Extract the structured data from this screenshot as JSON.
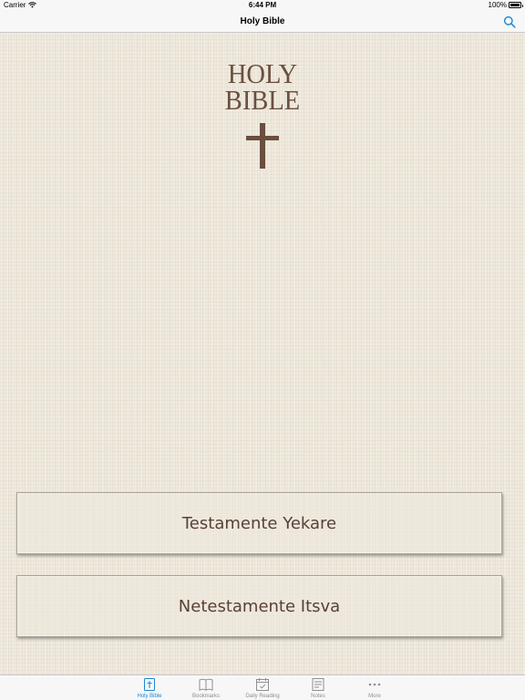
{
  "status_bar": {
    "carrier": "Carrier",
    "time": "6:44 PM",
    "battery": "100%"
  },
  "nav": {
    "title": "Holy Bible",
    "search_icon": "search-icon"
  },
  "logo": {
    "line1": "HOLY",
    "line2": "BIBLE",
    "icon": "cross-icon"
  },
  "books": {
    "old_testament": "Testamente Yekare",
    "new_testament": "Netestamente Itsva"
  },
  "tabs": [
    {
      "label": "Holy Bible",
      "icon": "bible-icon",
      "active": true
    },
    {
      "label": "Bookmarks",
      "icon": "book-open-icon",
      "active": false
    },
    {
      "label": "Daily Reading",
      "icon": "calendar-check-icon",
      "active": false
    },
    {
      "label": "Notes",
      "icon": "notes-icon",
      "active": false
    },
    {
      "label": "More",
      "icon": "more-icon",
      "active": false
    }
  ],
  "colors": {
    "accent": "#1a87d7",
    "brown_text": "#5a4036",
    "background": "#efe9dd"
  }
}
